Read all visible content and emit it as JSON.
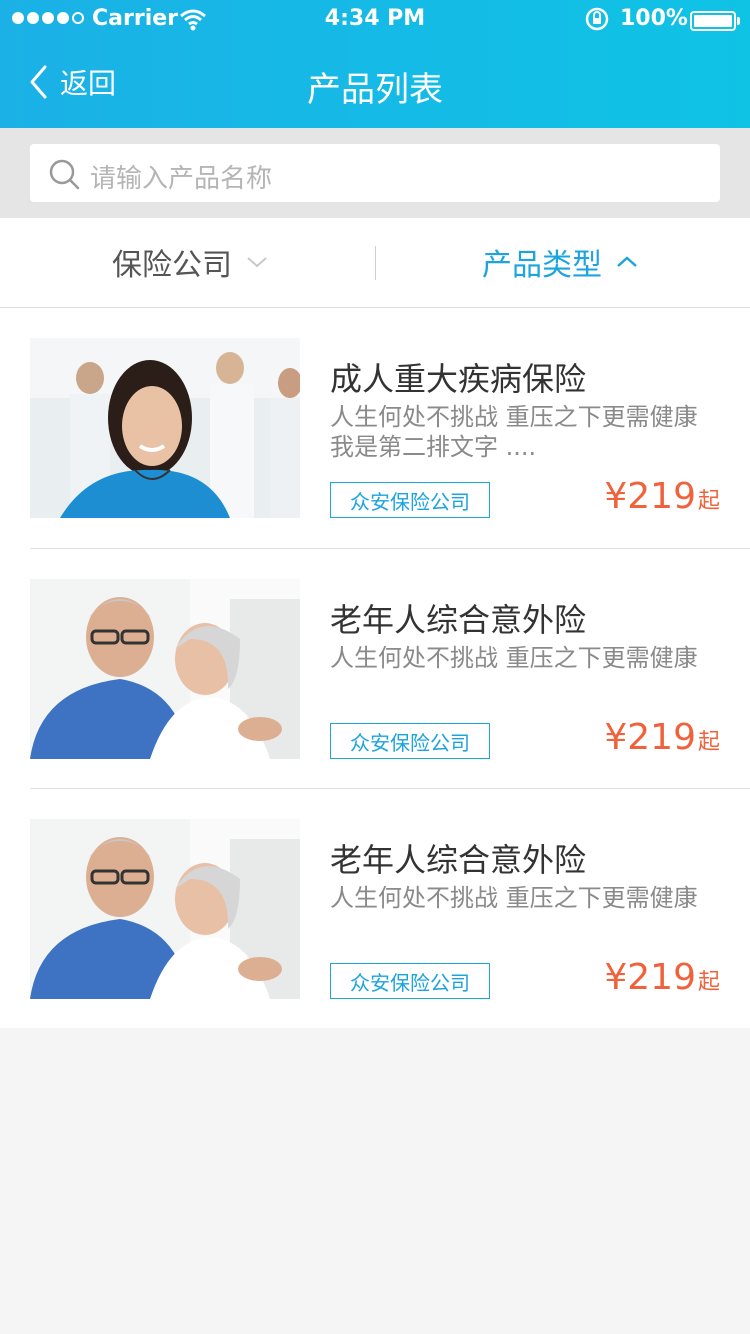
{
  "statusbar": {
    "carrier": "Carrier",
    "time": "4:34 PM",
    "battery": "100%"
  },
  "nav": {
    "back_label": "返回",
    "title": "产品列表"
  },
  "search": {
    "placeholder": "请输入产品名称"
  },
  "filters": {
    "company": "保险公司",
    "type": "产品类型"
  },
  "products": [
    {
      "title": "成人重大疾病保险",
      "desc": "人生何处不挑战 重压之下更需健康 我是第二排文字 ....",
      "tag": "众安保险公司",
      "price": "¥219",
      "price_suffix": "起"
    },
    {
      "title": "老年人综合意外险",
      "desc": "人生何处不挑战 重压之下更需健康",
      "tag": "众安保险公司",
      "price": "¥219",
      "price_suffix": "起"
    },
    {
      "title": "老年人综合意外险",
      "desc": "人生何处不挑战 重压之下更需健康",
      "tag": "众安保险公司",
      "price": "¥219",
      "price_suffix": "起"
    }
  ],
  "colors": {
    "header_start": "#1bb1e6",
    "header_end": "#0fc3e5",
    "accent": "#1ba4de",
    "price": "#f0623c"
  }
}
